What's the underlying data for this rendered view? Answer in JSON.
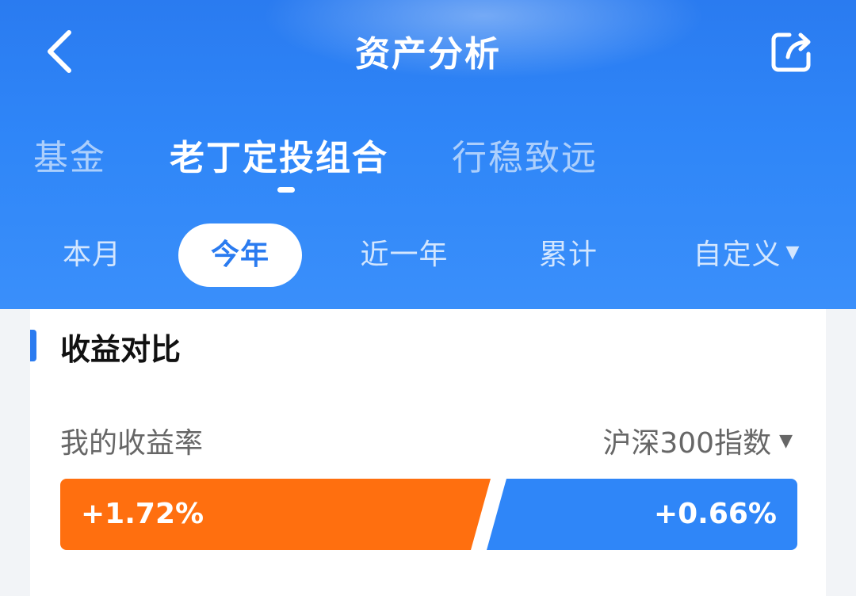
{
  "header": {
    "title": "资产分析",
    "back_icon": "chevron-left-icon",
    "share_icon": "share-icon"
  },
  "portfolio_tabs": [
    {
      "label": "基金",
      "active": false
    },
    {
      "label": "老丁定投组合",
      "active": true
    },
    {
      "label": "行稳致远",
      "active": false
    }
  ],
  "period_tabs": [
    {
      "label": "本月",
      "active": false
    },
    {
      "label": "今年",
      "active": true
    },
    {
      "label": "近一年",
      "active": false
    },
    {
      "label": "累计",
      "active": false
    },
    {
      "label": "自定义",
      "active": false,
      "has_dropdown": true
    }
  ],
  "card": {
    "title": "收益对比",
    "my_rate_label": "我的收益率",
    "index_select": "沪深300指数",
    "my_rate_value": "+1.72%",
    "index_rate_value": "+0.66%"
  },
  "colors": {
    "primary_blue": "#2a7bf0",
    "my_rate_orange": "#ff6f0f",
    "index_blue": "#2f86f8"
  }
}
